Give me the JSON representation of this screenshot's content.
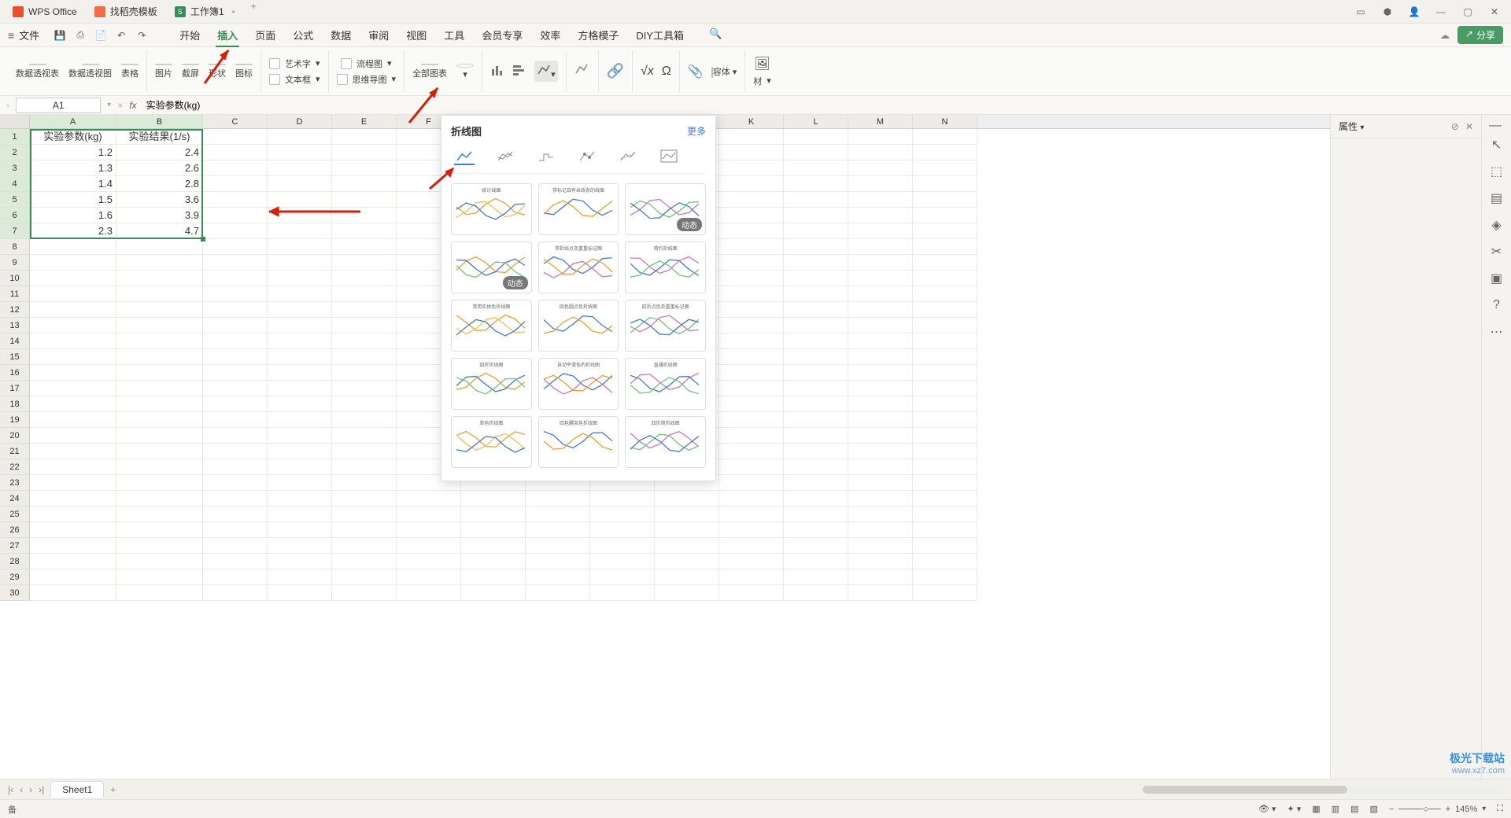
{
  "titlebar": {
    "tabs": [
      {
        "label": "WPS Office",
        "color": "#e94f2e"
      },
      {
        "label": "找稻壳模板",
        "color": "#f06c4a"
      },
      {
        "label": "工作簿1",
        "color": "#3a8b55",
        "active": true
      }
    ]
  },
  "menubar": {
    "file": "文件",
    "tabs": [
      "开始",
      "插入",
      "页面",
      "公式",
      "数据",
      "审阅",
      "视图",
      "工具",
      "会员专享",
      "效率",
      "方格模子",
      "DIY工具箱"
    ],
    "active_index": 1,
    "share": "分享"
  },
  "ribbon": {
    "g1": [
      "数据透视表",
      "数据透视图",
      "表格"
    ],
    "g2": [
      "图片",
      "截屏",
      "形状",
      "图标"
    ],
    "g2b": [
      "艺术字",
      "流程图",
      "文本框",
      "思维导图"
    ],
    "g3": [
      "全部图表"
    ],
    "g5": [
      "容体"
    ],
    "g6": [
      "材"
    ]
  },
  "namebox": {
    "value": "A1"
  },
  "formula": {
    "value": "实验参数(kg)"
  },
  "columns": [
    "A",
    "B",
    "C",
    "D",
    "E",
    "F",
    "G",
    "H",
    "I",
    "J",
    "K",
    "L",
    "M",
    "N"
  ],
  "rows": 30,
  "selected_rows": 7,
  "selected_cols": 2,
  "cells": [
    [
      "实验参数(kg)",
      "实验结果(1/s)"
    ],
    [
      "1.2",
      "2.4"
    ],
    [
      "1.3",
      "2.6"
    ],
    [
      "1.4",
      "2.8"
    ],
    [
      "1.5",
      "3.6"
    ],
    [
      "1.6",
      "3.9"
    ],
    [
      "2.3",
      "4.7"
    ]
  ],
  "chartpanel": {
    "title": "折线图",
    "more": "更多",
    "types": [
      "line",
      "multiline",
      "stepline",
      "markers",
      "trendline",
      "boxline"
    ],
    "thumbs": [
      {
        "title": "统计线图",
        "tag": ""
      },
      {
        "title": "带标记且有丝线条的线图",
        "tag": ""
      },
      {
        "title": "",
        "tag": "动态"
      },
      {
        "title": "",
        "tag": "动态"
      },
      {
        "title": "带折线点及重重标记图",
        "tag": ""
      },
      {
        "title": "简约折线图",
        "tag": ""
      },
      {
        "title": "常用实体色折线图",
        "tag": ""
      },
      {
        "title": "四色圆点色折线图",
        "tag": ""
      },
      {
        "title": "四折点色及重重标记图",
        "tag": ""
      },
      {
        "title": "四折折线图",
        "tag": ""
      },
      {
        "title": "自动平滑色的折线图",
        "tag": ""
      },
      {
        "title": "直通折线图",
        "tag": ""
      },
      {
        "title": "单色折线图",
        "tag": ""
      },
      {
        "title": "四色醒目色折线图",
        "tag": ""
      },
      {
        "title": "四折简折线图",
        "tag": ""
      }
    ]
  },
  "rightpanel": {
    "title": "属性"
  },
  "sheetbar": {
    "tab": "Sheet1"
  },
  "statusbar": {
    "ready": "备",
    "zoom": "145%"
  },
  "chart_data": {
    "type": "table",
    "title": "",
    "categories": [
      "实验参数(kg)",
      "实验结果(1/s)"
    ],
    "series": [
      {
        "name": "实验参数(kg)",
        "values": [
          1.2,
          1.3,
          1.4,
          1.5,
          1.6,
          2.3
        ]
      },
      {
        "name": "实验结果(1/s)",
        "values": [
          2.4,
          2.6,
          2.8,
          3.6,
          3.9,
          4.7
        ]
      }
    ]
  },
  "watermark": {
    "line1": "极光下载站",
    "line2": "www.xz7.com"
  }
}
